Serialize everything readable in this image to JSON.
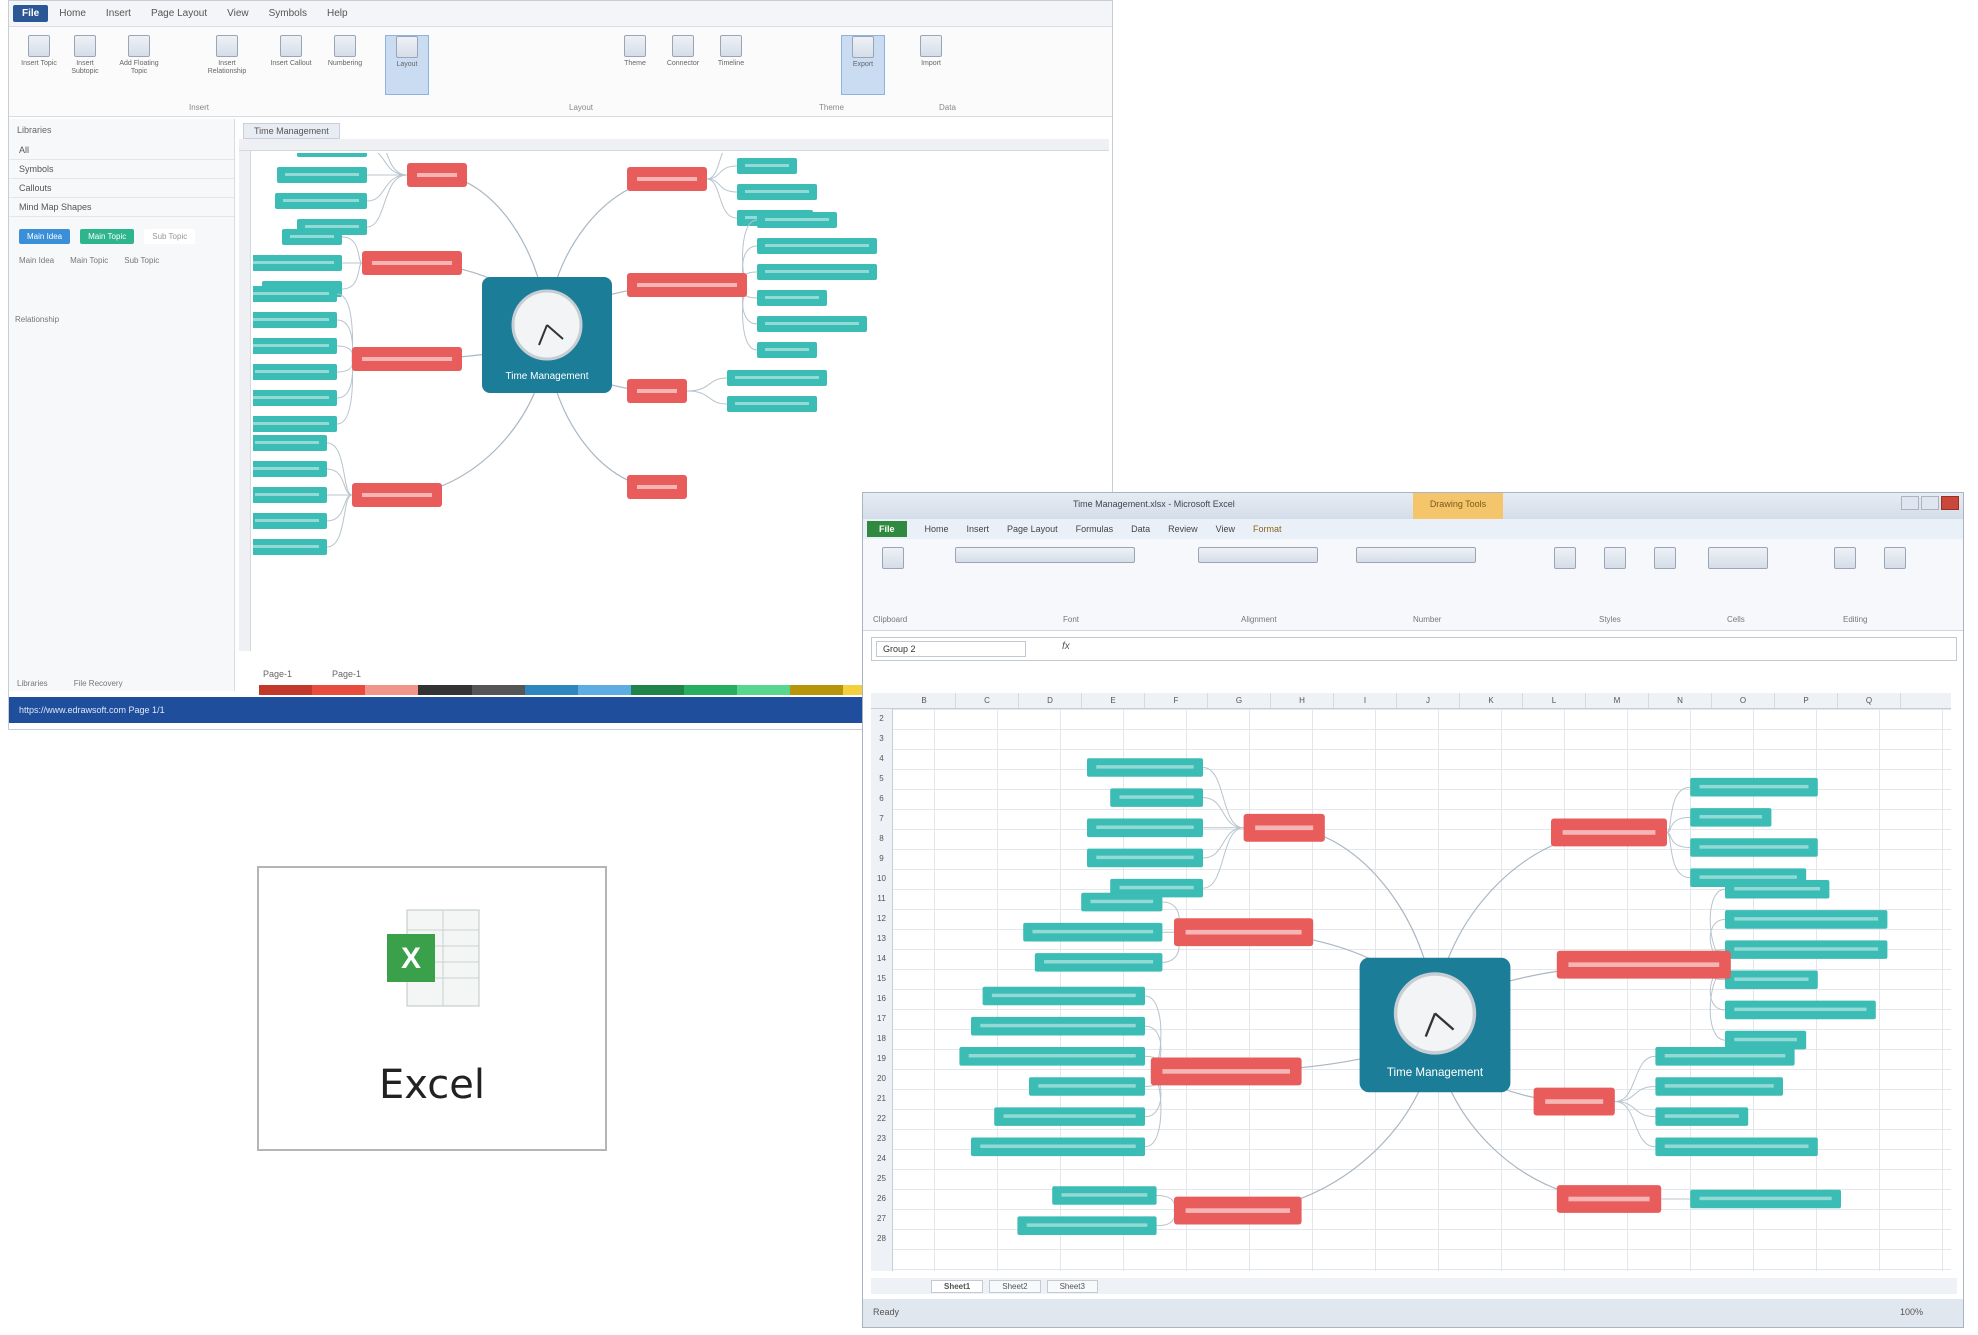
{
  "colors": {
    "topic": "#e85c5c",
    "subtopic": "#3bbcb4",
    "center": "#1c7d99",
    "visio_blue": "#2b5797",
    "excel_green": "#2f8a3f",
    "status": "#1f4e9c"
  },
  "center": {
    "label": "Time Management"
  },
  "mm_editor": {
    "menu": [
      "File",
      "Home",
      "Insert",
      "Page Layout",
      "View",
      "Symbols",
      "Help"
    ],
    "ribbon_buttons": [
      "Insert Topic",
      "Insert Subtopic",
      "Add Floating Topic",
      "Insert Relationship",
      "Insert Callout",
      "Numbering",
      "Layout",
      "Theme",
      "Connector",
      "Timeline",
      "Export",
      "Import"
    ],
    "ribbon_groups": [
      "Insert",
      "Layout",
      "Theme",
      "Data"
    ],
    "library": {
      "title": "Libraries",
      "search": "All",
      "sections": [
        "Symbols",
        "Callouts",
        "Mind Map Shapes"
      ],
      "chips": [
        "Main Idea",
        "Main Topic",
        "Sub Topic"
      ],
      "chip_labels": [
        "Main Idea",
        "Main Topic",
        "Sub Topic"
      ],
      "relationship": "Relationship"
    },
    "doc_tab": "Time Management",
    "page_tabs": [
      "Page-1",
      "Page-1"
    ],
    "bottom_tabs": [
      "Libraries",
      "File Recovery"
    ],
    "status": "https://www.edrawsoft.com   Page 1/1"
  },
  "excel_card": {
    "label": "Excel"
  },
  "excel": {
    "title": "Time Management.xlsx - Microsoft Excel",
    "context_title": "Drawing Tools",
    "tabs": [
      "File",
      "Home",
      "Insert",
      "Page Layout",
      "Formulas",
      "Data",
      "Review",
      "View",
      "Format"
    ],
    "ribbon_groups": [
      "Clipboard",
      "Font",
      "Alignment",
      "Number",
      "Styles",
      "Cells",
      "Editing"
    ],
    "namebox": "Group 2",
    "fx": "fx",
    "columns": [
      "B",
      "C",
      "D",
      "E",
      "F",
      "G",
      "H",
      "I",
      "J",
      "K",
      "L",
      "M",
      "N",
      "O",
      "P",
      "Q"
    ],
    "rows": [
      "2",
      "3",
      "4",
      "5",
      "6",
      "7",
      "8",
      "9",
      "10",
      "11",
      "12",
      "13",
      "14",
      "15",
      "16",
      "17",
      "18",
      "19",
      "20",
      "21",
      "22",
      "23",
      "24",
      "25",
      "26",
      "27",
      "28"
    ],
    "sheets": [
      "Sheet1",
      "Sheet2",
      "Sheet3"
    ],
    "status": "Ready",
    "zoom": "100%"
  }
}
